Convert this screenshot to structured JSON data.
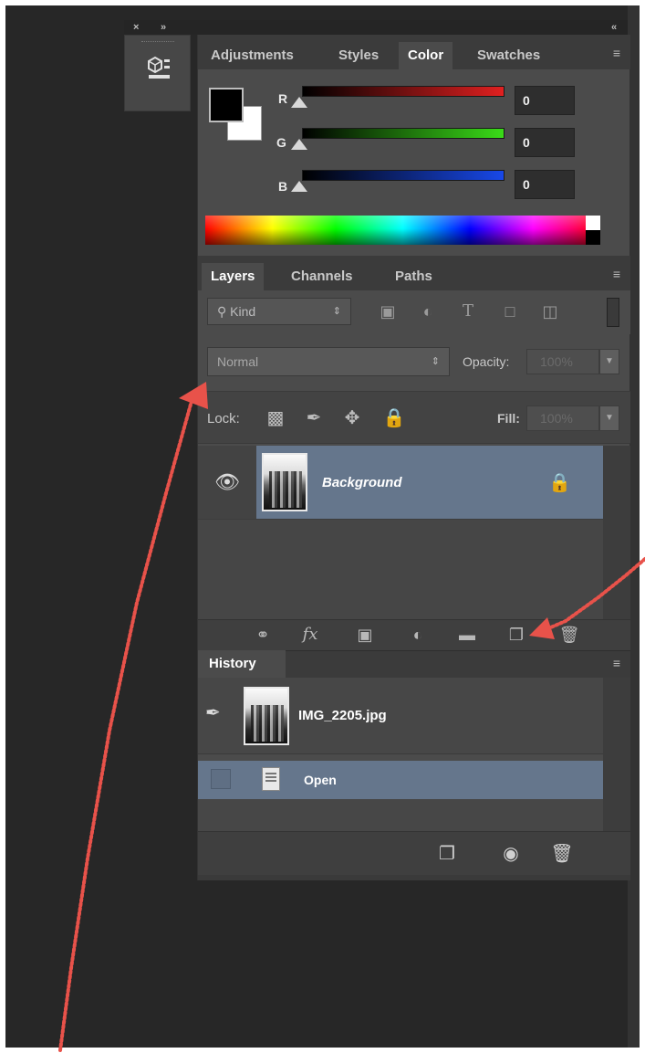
{
  "topbar": {
    "close_glyph": "×",
    "expand_glyph": "»",
    "collapse_glyph": "«"
  },
  "color_panel": {
    "tabs": [
      "Adjustments",
      "Styles",
      "Color",
      "Swatches"
    ],
    "active_tab": "Color",
    "menu_glyph": "≡",
    "channels": [
      {
        "label": "R",
        "value": "0",
        "color": "#e02020"
      },
      {
        "label": "G",
        "value": "0",
        "color": "#3adb18"
      },
      {
        "label": "B",
        "value": "0",
        "color": "#1848e8"
      }
    ],
    "foreground_color": "#000000",
    "background_color": "#ffffff"
  },
  "layers_panel": {
    "tabs": [
      "Layers",
      "Channels",
      "Paths"
    ],
    "active_tab": "Layers",
    "filter_kind": "Kind",
    "blend_mode": "Normal",
    "opacity_label": "Opacity:",
    "opacity_value": "100%",
    "lock_label": "Lock:",
    "fill_label": "Fill:",
    "fill_value": "100%",
    "layer": {
      "name": "Background",
      "visible": true,
      "locked": true
    },
    "selection_color": "#65768c"
  },
  "history_panel": {
    "tab": "History",
    "snapshot": "IMG_2205.jpg",
    "states": [
      "Open"
    ]
  },
  "annotation": {
    "arrow_color": "#e8524a"
  }
}
